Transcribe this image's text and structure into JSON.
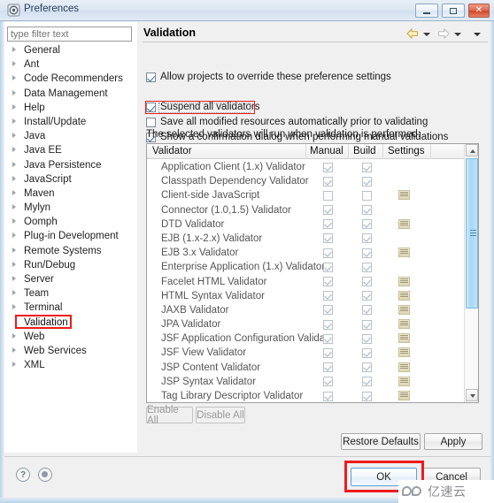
{
  "window": {
    "title": "Preferences",
    "icon": "preferences-icon",
    "controls": {
      "minimize": "minimize-icon",
      "maximize": "maximize-icon",
      "close": "close-icon"
    }
  },
  "sidebar": {
    "filter": {
      "value": "",
      "placeholder": "type filter text"
    },
    "selected": "Validation",
    "items": [
      {
        "label": "General",
        "expandable": true
      },
      {
        "label": "Ant",
        "expandable": true
      },
      {
        "label": "Code Recommenders",
        "expandable": true
      },
      {
        "label": "Data Management",
        "expandable": true
      },
      {
        "label": "Help",
        "expandable": true
      },
      {
        "label": "Install/Update",
        "expandable": true
      },
      {
        "label": "Java",
        "expandable": true
      },
      {
        "label": "Java EE",
        "expandable": true
      },
      {
        "label": "Java Persistence",
        "expandable": true
      },
      {
        "label": "JavaScript",
        "expandable": true
      },
      {
        "label": "Maven",
        "expandable": true
      },
      {
        "label": "Mylyn",
        "expandable": true
      },
      {
        "label": "Oomph",
        "expandable": true
      },
      {
        "label": "Plug-in Development",
        "expandable": true
      },
      {
        "label": "Remote Systems",
        "expandable": true
      },
      {
        "label": "Run/Debug",
        "expandable": true
      },
      {
        "label": "Server",
        "expandable": true
      },
      {
        "label": "Team",
        "expandable": true
      },
      {
        "label": "Terminal",
        "expandable": true
      },
      {
        "label": "Validation",
        "expandable": false
      },
      {
        "label": "Web",
        "expandable": true
      },
      {
        "label": "Web Services",
        "expandable": true
      },
      {
        "label": "XML",
        "expandable": true
      }
    ]
  },
  "page": {
    "title": "Validation",
    "nav": {
      "back": "back-arrow-icon",
      "forward": "forward-arrow-icon",
      "menu": "dropdown-caret-icon"
    },
    "options": [
      {
        "label": "Allow projects to override these preference settings",
        "checked": true,
        "mnemonic": "o"
      },
      {
        "label": "Suspend all validators",
        "checked": true,
        "mnemonic": "u",
        "highlighted": true,
        "focused": true
      },
      {
        "label": "Save all modified resources automatically prior to validating",
        "checked": false,
        "mnemonic": "S"
      },
      {
        "label": "Show a confirmation dialog when performing manual validations",
        "checked": true,
        "mnemonic": "c"
      }
    ],
    "lead_text": "The selected validators will run when validation is performed:",
    "table": {
      "columns": [
        "Validator",
        "Manual",
        "Build",
        "Settings"
      ],
      "rows": [
        {
          "name": "Application Client (1.x) Validator",
          "manual": true,
          "build": true,
          "settings": false
        },
        {
          "name": "Classpath Dependency Validator",
          "manual": true,
          "build": true,
          "settings": false
        },
        {
          "name": "Client-side JavaScript",
          "manual": false,
          "build": false,
          "settings": true
        },
        {
          "name": "Connector (1.0,1.5) Validator",
          "manual": true,
          "build": true,
          "settings": false
        },
        {
          "name": "DTD Validator",
          "manual": true,
          "build": true,
          "settings": true
        },
        {
          "name": "EJB (1.x-2.x) Validator",
          "manual": true,
          "build": true,
          "settings": false
        },
        {
          "name": "EJB 3.x Validator",
          "manual": true,
          "build": true,
          "settings": true
        },
        {
          "name": "Enterprise Application (1.x) Validator",
          "manual": true,
          "build": true,
          "settings": false
        },
        {
          "name": "Facelet HTML Validator",
          "manual": true,
          "build": true,
          "settings": true
        },
        {
          "name": "HTML Syntax Validator",
          "manual": true,
          "build": true,
          "settings": true
        },
        {
          "name": "JAXB Validator",
          "manual": true,
          "build": true,
          "settings": true
        },
        {
          "name": "JPA Validator",
          "manual": true,
          "build": true,
          "settings": true
        },
        {
          "name": "JSF Application Configuration Valida...",
          "manual": true,
          "build": true,
          "settings": true
        },
        {
          "name": "JSF View Validator",
          "manual": true,
          "build": true,
          "settings": true
        },
        {
          "name": "JSP Content Validator",
          "manual": true,
          "build": true,
          "settings": true
        },
        {
          "name": "JSP Syntax Validator",
          "manual": true,
          "build": true,
          "settings": true
        },
        {
          "name": "Tag Library Descriptor Validator",
          "manual": true,
          "build": true,
          "settings": true
        }
      ]
    },
    "buttons": {
      "enable_all": "Enable All",
      "disable_all": "Disable All",
      "restore_defaults": "Restore Defaults",
      "apply": "Apply"
    }
  },
  "footer": {
    "help_icon": "help-question-icon",
    "apply_close_icon": "apply-and-close-icon",
    "ok": "OK",
    "cancel": "Cancel",
    "ok_highlighted": true
  },
  "watermark": {
    "text": "亿速云",
    "logo": "cloud-logo-icon"
  },
  "colors": {
    "highlight_red": "#ee1c1c",
    "titlebar_blue": "#d2dff0",
    "scrollbar_blue": "#a8d8f6",
    "ok_border": "#5aa0d8"
  }
}
